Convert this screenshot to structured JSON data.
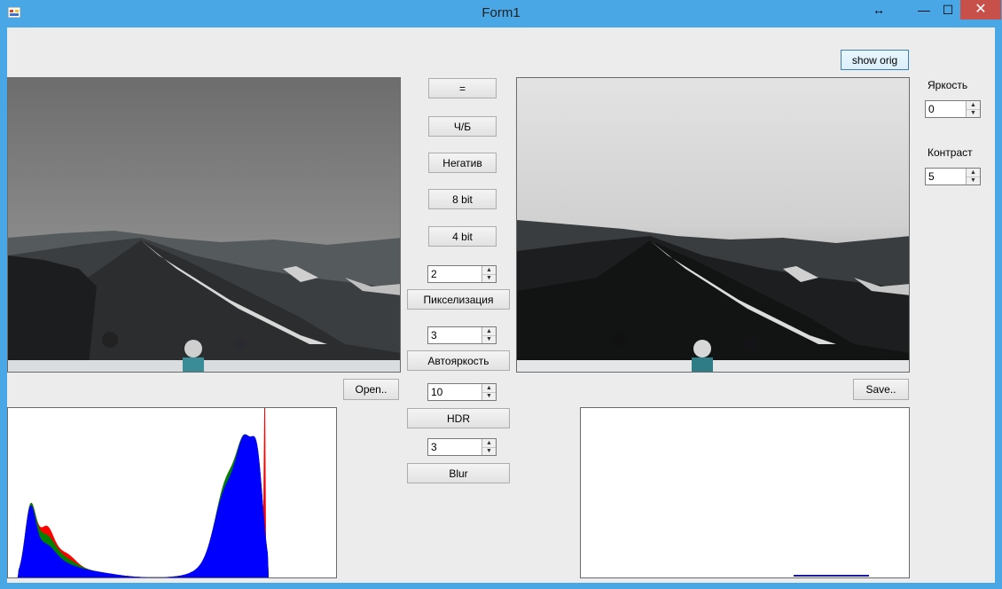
{
  "window": {
    "title": "Form1",
    "controls": {
      "resize": "↔",
      "minimize": "—",
      "maximize": "☐",
      "close": "✕"
    }
  },
  "buttons": {
    "show_orig": "show orig",
    "equals": "=",
    "bw": "Ч/Б",
    "negative": "Негатив",
    "bit8": "8 bit",
    "bit4": "4 bit",
    "pixelization": "Пикселизация",
    "autobrightness": "Автояркость",
    "hdr": "HDR",
    "blur": "Blur",
    "open": "Open..",
    "save": "Save.."
  },
  "spinners": {
    "pixel_size": "2",
    "autobright_level": "3",
    "hdr_level": "10",
    "blur_radius": "3",
    "brightness": "0",
    "contrast": "5"
  },
  "labels": {
    "brightness": "Яркость",
    "contrast": "Контраст"
  },
  "colors": {
    "titlebar": "#4aa7e6",
    "close_button": "#c7504b",
    "form_background": "#ececec",
    "hist_red": "#ff0000",
    "hist_green": "#008000",
    "hist_blue": "#0000ff"
  },
  "histogram_left": {
    "channels": [
      "red",
      "green",
      "blue"
    ]
  }
}
